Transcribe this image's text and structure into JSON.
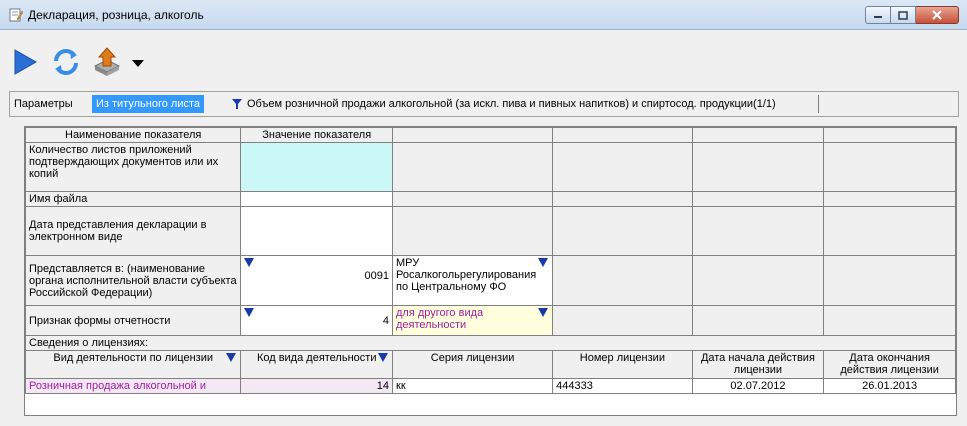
{
  "window": {
    "title": "Декларация, розница, алкоголь",
    "icons": {
      "title": "notepad-pencil-icon",
      "minimize": "minimize-icon",
      "maximize": "maximize-icon",
      "close": "close-icon"
    }
  },
  "toolbar": {
    "items": [
      {
        "name": "play-icon",
        "color": "#2a6fd8"
      },
      {
        "name": "refresh-icon",
        "color": "#2a6fd8"
      },
      {
        "name": "export-icon",
        "color": "#e07a1f"
      },
      {
        "name": "dropdown-arrow-icon",
        "color": "#000000"
      }
    ]
  },
  "tabs": {
    "parameters": "Параметры",
    "from_title": "Из титульного листа",
    "filter_icon": "filter-icon",
    "volume": "Объем розничной продажи алкогольной (за искл. пива и пивных напитков) и спиртосод. продукции(1/1)"
  },
  "grid": {
    "headers": {
      "indicator_name": "Наименование показателя",
      "indicator_value": "Значение показателя"
    },
    "rows": {
      "sheets_count_label": "Количество листов приложений подтверждающих документов или их копий",
      "file_name_label": "Имя файла",
      "submission_date_label": "Дата представления декларации в электронном виде",
      "submitted_to_label": "Представляется в: (наименование органа исполнительной власти субъекта Российской Федерации)",
      "submitted_to_code": "0091",
      "submitted_to_name": "МРУ Росалкогольрегулирования по Центральному ФО",
      "form_sign_label": "Признак формы отчетности",
      "form_sign_code": "4",
      "form_sign_name": "для другого вида деятельности"
    },
    "license_section": "Сведения о лицензиях:",
    "license_headers": {
      "activity": "Вид деятельности по лицензии",
      "activity_code": "Код вида деятельности",
      "series": "Серия лицензии",
      "number": "Номер лицензии",
      "start_date": "Дата начала действия лицензии",
      "end_date": "Дата окончания действия лицензии"
    },
    "license_row": {
      "activity": "Розничная продажа алкогольной и",
      "activity_code": "14",
      "series": "кк",
      "number": "444333",
      "start_date": "02.07.2012",
      "end_date": "26.01.2013"
    }
  },
  "colors": {
    "tab_active": "#3399ff",
    "cyan_input": "#ccf7f7",
    "lookup_text": "#a020a0",
    "dropdown_marker": "#1a3aa8"
  }
}
